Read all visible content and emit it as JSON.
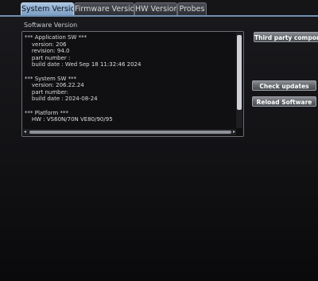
{
  "tabs": [
    {
      "label": "System Version",
      "active": true
    },
    {
      "label": "Firmware Version",
      "active": false
    },
    {
      "label": "HW Version",
      "active": false
    },
    {
      "label": "Probes",
      "active": false
    }
  ],
  "section_title": "Software Version",
  "info_lines": [
    "*** Application SW ***",
    "    version: 206",
    "    revision: 94.0",
    "    part number :",
    "    build date : Wed Sep 18 11:32:46 2024",
    "",
    "*** System SW ***",
    "    version: 206.22.24",
    "    part number:",
    "    build date : 2024-08-24",
    "",
    "*** Platform ***",
    "    HW : VS60N/70N VE80/90/95"
  ],
  "buttons": {
    "third_party": "Third party compone",
    "check_updates": "Check updates",
    "reload_software": "Reload Software"
  },
  "scroll_arrows": {
    "left": "◂",
    "right": "▸"
  },
  "colors": {
    "active_tab": "#8fb0d4",
    "background": "#121215",
    "button": "#6a6d73"
  }
}
